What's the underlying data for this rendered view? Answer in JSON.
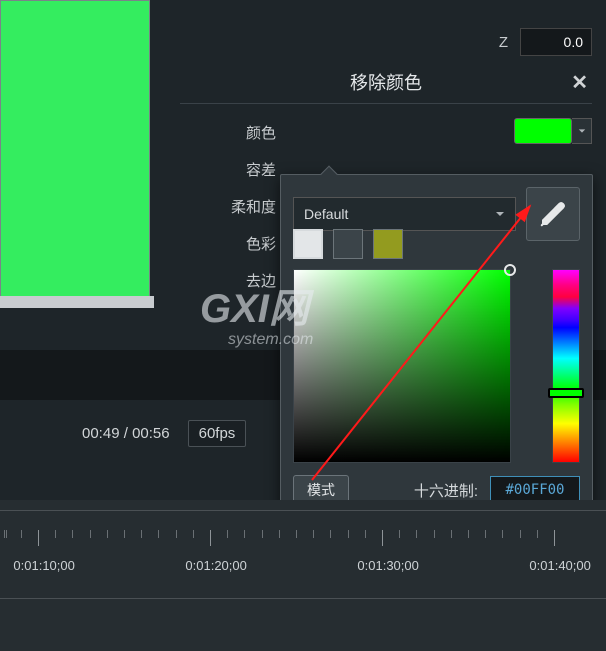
{
  "z_control": {
    "label": "Z",
    "value": "0.0"
  },
  "panel": {
    "title": "移除颜色",
    "params": {
      "color": "颜色",
      "tolerance": "容差",
      "softness": "柔和度",
      "saturation": "色彩",
      "defringe": "去边"
    }
  },
  "color_picker": {
    "preset_label": "Default",
    "swatches": [
      "#e3e6e8",
      "#3b4449",
      "#939b1f"
    ],
    "current_hex": "#00FF00",
    "mode_label": "模式",
    "hex_label": "十六进制:",
    "eyedropper": "eyedropper"
  },
  "playback": {
    "current_time": "00:49",
    "total_time": "00:56",
    "fps": "60fps"
  },
  "timeline": {
    "ticks": [
      "0:01:10;00",
      "0:01:20;00",
      "0:01:30;00",
      "0:01:40;00"
    ]
  },
  "watermark": {
    "line1": "GXI网",
    "line2": "system.com"
  }
}
